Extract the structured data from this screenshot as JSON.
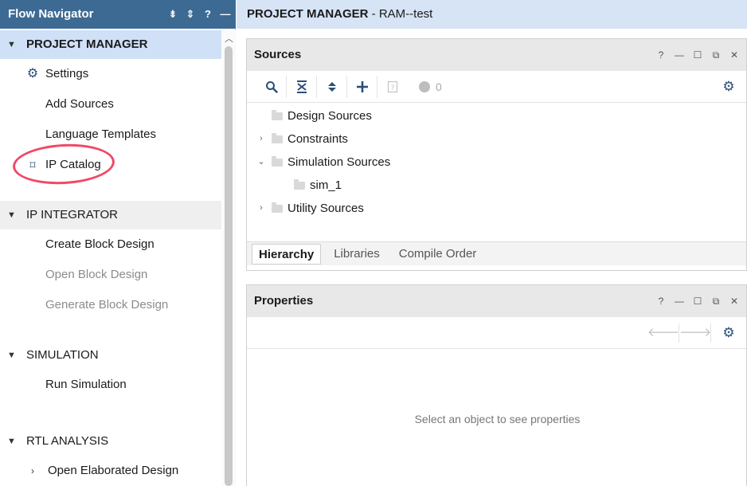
{
  "nav": {
    "title": "Flow Navigator",
    "sections": {
      "project_manager": {
        "label": "PROJECT MANAGER",
        "items": {
          "settings": "Settings",
          "add_sources": "Add Sources",
          "language_templates": "Language Templates",
          "ip_catalog": "IP Catalog"
        }
      },
      "ip_integrator": {
        "label": "IP INTEGRATOR",
        "items": {
          "create_block_design": "Create Block Design",
          "open_block_design": "Open Block Design",
          "generate_block_design": "Generate Block Design"
        }
      },
      "simulation": {
        "label": "SIMULATION",
        "items": {
          "run_simulation": "Run Simulation"
        }
      },
      "rtl_analysis": {
        "label": "RTL ANALYSIS",
        "items": {
          "open_elaborated_design": "Open Elaborated Design"
        }
      }
    }
  },
  "title_bar": {
    "section": "PROJECT MANAGER",
    "project": " - RAM--test"
  },
  "sources": {
    "title": "Sources",
    "status_count": "0",
    "tree": {
      "design_sources": "Design Sources",
      "constraints": "Constraints",
      "simulation_sources": "Simulation Sources",
      "sim_1": "sim_1",
      "utility_sources": "Utility Sources"
    },
    "tabs": {
      "hierarchy": "Hierarchy",
      "libraries": "Libraries",
      "compile_order": "Compile Order"
    }
  },
  "properties": {
    "title": "Properties",
    "empty_message": "Select an object to see properties"
  },
  "colors": {
    "nav_header": "#3d6a93",
    "title_bar": "#d6e4f6",
    "active_section": "#cfe0f7",
    "annotation_circle": "#ef4a67"
  }
}
